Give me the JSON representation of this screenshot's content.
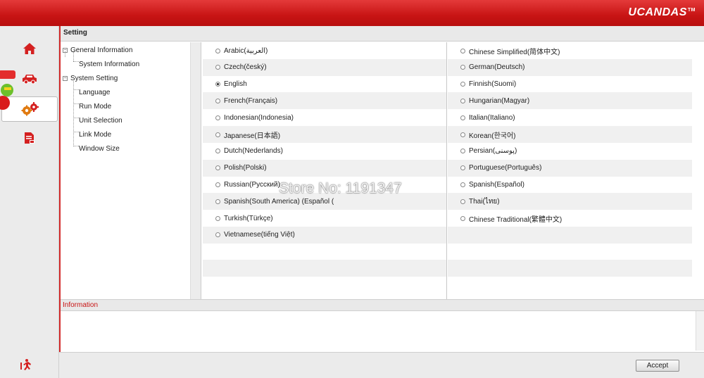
{
  "brand": {
    "name": "UCANDAS",
    "tm": "TM"
  },
  "header": {
    "title": "Setting"
  },
  "tree": {
    "items": [
      {
        "label": "General Information",
        "level": 0
      },
      {
        "label": "System Information",
        "level": 1
      },
      {
        "label": "System Setting",
        "level": 0
      },
      {
        "label": "Language",
        "level": 1
      },
      {
        "label": "Run Mode",
        "level": 1
      },
      {
        "label": "Unit Selection",
        "level": 1
      },
      {
        "label": "Link Mode",
        "level": 1
      },
      {
        "label": "Window Size",
        "level": 1
      }
    ]
  },
  "languages": {
    "left": [
      "Arabic(العربية)",
      "Czech(český)",
      "English",
      "French(Français)",
      "Indonesian(Indonesia)",
      "Japanese(日本語)",
      "Dutch(Nederlands)",
      "Polish(Polski)",
      "Russian(Русский)",
      "Spanish(South America) (Español (",
      "Turkish(Türkçe)",
      "Vietnamese(tiếng Việt)"
    ],
    "right": [
      "Chinese Simplified(简体中文)",
      "German(Deutsch)",
      "Finnish(Suomi)",
      "Hungarian(Magyar)",
      "Italian(Italiano)",
      "Korean(한국어)",
      "Persian(پوسنی)",
      "Portuguese(Português)",
      "Spanish(Español)",
      "Thai(ไทย)",
      "Chinese Traditional(繁體中文)"
    ],
    "selected": "English"
  },
  "info": {
    "title": "Information",
    "text": ""
  },
  "footer": {
    "accept_label": "Accept"
  },
  "watermark": "Store No: 1191347",
  "colors": {
    "accent": "#c81414",
    "topbar": "#d42424"
  },
  "icons": [
    "home-icon",
    "car-icon",
    "gears-icon",
    "report-icon",
    "exit-icon"
  ]
}
